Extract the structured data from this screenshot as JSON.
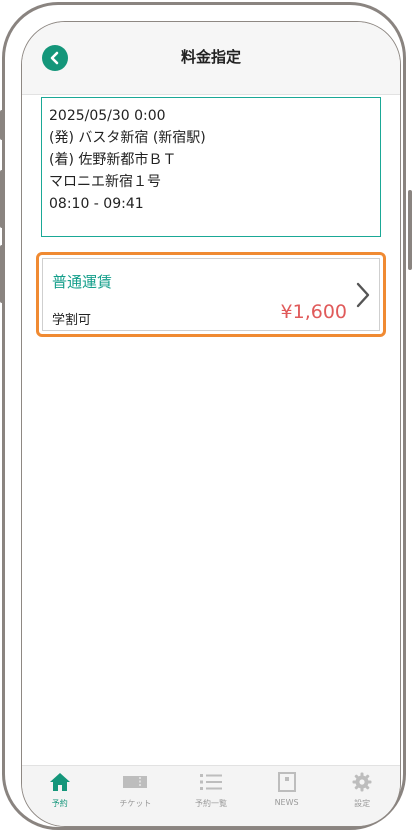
{
  "header": {
    "title": "料金指定"
  },
  "trip": {
    "date": "2025/05/30 0:00",
    "departure": "(発) バスタ新宿 (新宿駅)",
    "arrival": "(着) 佐野新都市ＢＴ",
    "via": "マロニエ新宿１号",
    "time": "08:10 - 09:41"
  },
  "fare": {
    "name": "普通運賃",
    "note": "学割可",
    "price": "¥1,600"
  },
  "tabs": [
    {
      "label": "予約",
      "icon": "home-icon",
      "active": true
    },
    {
      "label": "チケット",
      "icon": "ticket-icon",
      "active": false
    },
    {
      "label": "予約一覧",
      "icon": "list-icon",
      "active": false
    },
    {
      "label": "NEWS",
      "icon": "news-icon",
      "active": false
    },
    {
      "label": "設定",
      "icon": "gear-icon",
      "active": false
    }
  ],
  "colors": {
    "accent": "#14967a",
    "price": "#e05a5a",
    "highlight": "#f08a32"
  }
}
